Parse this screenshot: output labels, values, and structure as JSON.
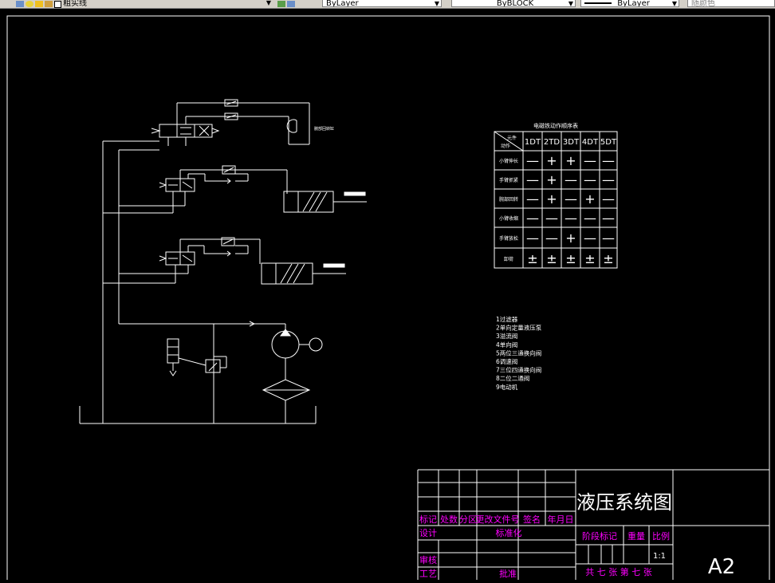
{
  "toolbar": {
    "layer_name": "粗实线",
    "color_value": "ByLayer",
    "linetype_value": "ByBLOCK",
    "lineweight_value": "ByLayer",
    "plotstyle_value": "随颜色"
  },
  "table": {
    "title": "电磁铁动作顺序表",
    "header_corner_top": "元件",
    "header_corner_bottom": "动作",
    "columns": [
      "1DT",
      "2TD",
      "3DT",
      "4DT",
      "5DT"
    ],
    "rows": [
      {
        "label": "小臂伸长",
        "values": [
          "—",
          "+",
          "+",
          "—",
          "—"
        ]
      },
      {
        "label": "手臂抓紧",
        "values": [
          "—",
          "+",
          "—",
          "—",
          "—"
        ]
      },
      {
        "label": "腕部回转",
        "values": [
          "—",
          "+",
          "—",
          "+",
          "—"
        ]
      },
      {
        "label": "小臂收缩",
        "values": [
          "—",
          "—",
          "—",
          "—",
          "—"
        ]
      },
      {
        "label": "手臂放松",
        "values": [
          "—",
          "—",
          "+",
          "—",
          "—"
        ]
      },
      {
        "label": "卸荷",
        "values": [
          "±",
          "±",
          "±",
          "±",
          "±"
        ]
      }
    ]
  },
  "legend": [
    "1过滤器",
    "2单向定量液压泵",
    "3溢流阀",
    "4单向阀",
    "5两位三通换向阀",
    "6调速阀",
    "7三位四通换向阀",
    "8二位二通阀",
    "9电动机"
  ],
  "diagram": {
    "motor_label": "腕部回转缸"
  },
  "title_block": {
    "drawing_title": "液压系统图",
    "sheet_size": "A2",
    "scale": "1:1",
    "labels": {
      "mark": "标记",
      "count": "处数",
      "zone": "分区",
      "change_doc": "更改文件号",
      "sign": "签名",
      "date": "年月日",
      "design": "设计",
      "standard": "标准化",
      "stage": "阶段标记",
      "weight": "重量",
      "ratio": "比例",
      "review": "审核",
      "process": "工艺",
      "approve": "批准",
      "sheets": "共 七  张 第 七 张"
    }
  },
  "colors": {
    "background": "#000000",
    "line": "#ffffff",
    "text_magenta": "#ff00ff"
  }
}
